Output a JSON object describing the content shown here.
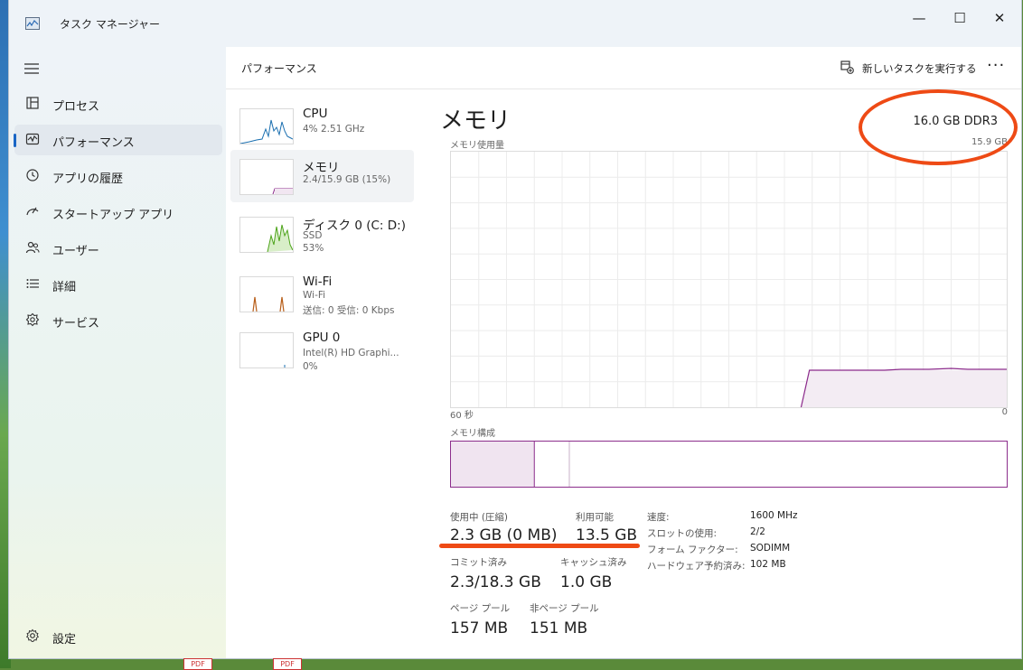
{
  "window": {
    "title": "タスク マネージャー",
    "minimize_glyph": "—",
    "maximize_glyph": "☐",
    "close_glyph": "✕"
  },
  "sidebar": {
    "items": [
      {
        "label": "プロセス",
        "icon": "processes-icon",
        "active": false
      },
      {
        "label": "パフォーマンス",
        "icon": "performance-icon",
        "active": true
      },
      {
        "label": "アプリの履歴",
        "icon": "history-icon",
        "active": false
      },
      {
        "label": "スタートアップ アプリ",
        "icon": "startup-icon",
        "active": false
      },
      {
        "label": "ユーザー",
        "icon": "users-icon",
        "active": false
      },
      {
        "label": "詳細",
        "icon": "details-icon",
        "active": false
      },
      {
        "label": "サービス",
        "icon": "services-icon",
        "active": false
      }
    ],
    "settings_label": "設定"
  },
  "header": {
    "title": "パフォーマンス",
    "new_task_label": "新しいタスクを実行する",
    "more_glyph": "···"
  },
  "resources": [
    {
      "name": "CPU",
      "sub1": "4%  2.51 GHz",
      "sub2": "",
      "color": "#1a6fb0"
    },
    {
      "name": "メモリ",
      "sub1": "2.4/15.9 GB (15%)",
      "sub2": "",
      "color": "#8b2a8b"
    },
    {
      "name": "ディスク 0 (C: D:)",
      "sub1": "SSD",
      "sub2": "53%",
      "color": "#4da41a"
    },
    {
      "name": "Wi-Fi",
      "sub1": "Wi-Fi",
      "sub2": "送信: 0 受信: 0 Kbps",
      "color": "#b85f1a"
    },
    {
      "name": "GPU 0",
      "sub1": "Intel(R) HD Graphi...",
      "sub2": "0%",
      "color": "#1a6fb0"
    }
  ],
  "memory": {
    "title": "メモリ",
    "type": "16.0 GB DDR3",
    "usage_label": "メモリ使用量",
    "max_label": "15.9 GB",
    "time_left": "60 秒",
    "time_right": "0",
    "composition_label": "メモリ構成",
    "usage_level": 0.145,
    "composition": {
      "in_use": 0.15,
      "modified": 0.003,
      "standby": 0.06
    },
    "stats": {
      "in_use_label": "使用中 (圧縮)",
      "in_use_value": "2.3 GB (0 MB)",
      "available_label": "利用可能",
      "available_value": "13.5 GB",
      "committed_label": "コミット済み",
      "committed_value": "2.3/18.3 GB",
      "cached_label": "キャッシュ済み",
      "cached_value": "1.0 GB",
      "paged_label": "ページ プール",
      "paged_value": "157 MB",
      "nonpaged_label": "非ページ プール",
      "nonpaged_value": "151 MB"
    },
    "details": [
      {
        "key": "速度:",
        "value": "1600 MHz"
      },
      {
        "key": "スロットの使用:",
        "value": "2/2"
      },
      {
        "key": "フォーム ファクター:",
        "value": "SODIMM"
      },
      {
        "key": "ハードウェア予約済み:",
        "value": "102 MB"
      }
    ]
  },
  "colors": {
    "accent": "#1a66c5",
    "memory": "#8b2a8b",
    "annotation": "#ee4a15"
  },
  "taskbar": {
    "thumb_label": "PDF"
  }
}
